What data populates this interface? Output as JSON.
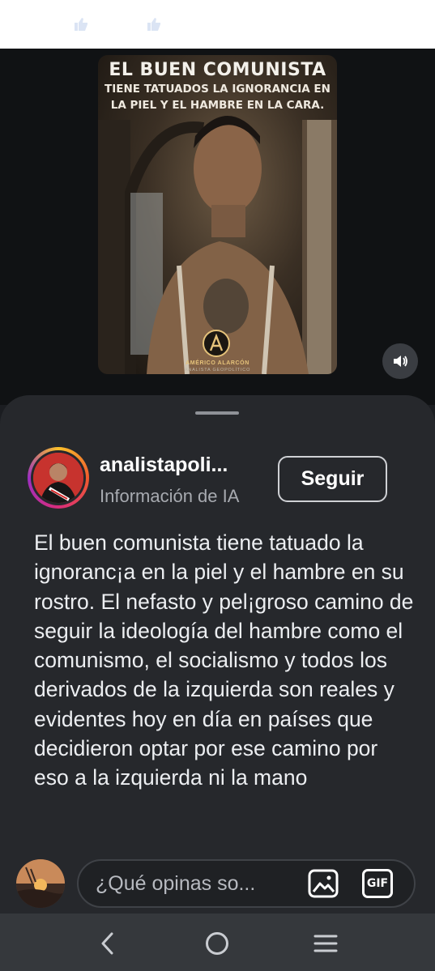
{
  "poster": {
    "title": "EL BUEN COMUNISTA",
    "subtitle": "TIENE TATUADOS LA IGNORANCIA EN\nLA PIEL Y EL HAMBRE EN LA CARA.",
    "author": "AMÉRICO ALARCÓN",
    "role": "ANALISTA GEOPOLÍTICO",
    "logo_letter": "A"
  },
  "post": {
    "username": "analistapoli...",
    "subtitle": "Información de IA",
    "follow_label": "Seguir",
    "caption": "El buen comunista tiene tatuado la ignoranc¡a en la piel y el hambre en su rostro. El nefasto y pel¡groso camino de seguir la ideología del hambre como el comunismo, el socialismo y todos los derivados de la izquierda son reales y evidentes hoy en día en países que decidieron optar por ese camino por eso a la izquierda ni la mano"
  },
  "comment": {
    "placeholder": "¿Qué opinas so...",
    "gif_label": "GIF"
  },
  "icons": {
    "sound": "speaker-icon",
    "image": "image-icon",
    "gif": "gif-icon",
    "back": "back-chevron-icon",
    "home": "home-circle-icon",
    "recents": "recents-lines-icon"
  },
  "colors": {
    "sheet": "#26282c",
    "background": "#1b1d21",
    "navbar": "#35383c",
    "ring_start": "#f9c02a",
    "ring_end": "#9b2fc2"
  }
}
